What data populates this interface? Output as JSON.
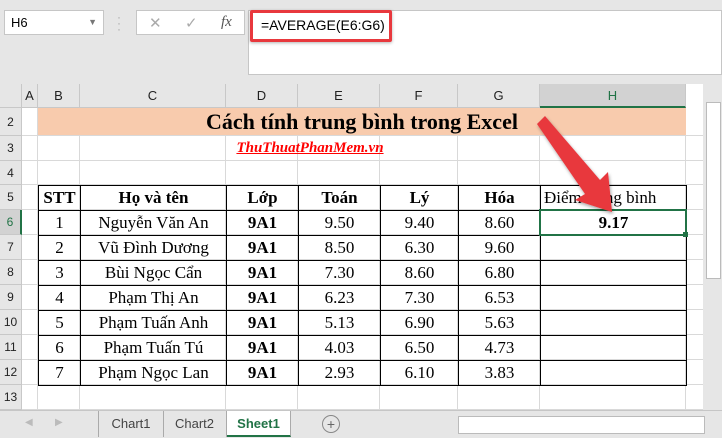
{
  "name_box": "H6",
  "formula_bar": {
    "cancel_icon": "✕",
    "enter_icon": "✓",
    "fx_label": "fx",
    "formula": "=AVERAGE(E6:G6)"
  },
  "columns": [
    "A",
    "B",
    "C",
    "D",
    "E",
    "F",
    "G",
    "H"
  ],
  "rows": [
    "2",
    "3",
    "4",
    "5",
    "6",
    "7",
    "8",
    "9",
    "10",
    "11",
    "12",
    "13"
  ],
  "title": "Cách tính trung bình trong Excel",
  "subtitle": "ThuThuatPhanMem.vn",
  "headers": [
    "STT",
    "Họ và tên",
    "Lớp",
    "Toán",
    "Lý",
    "Hóa",
    "Điểm trung bình"
  ],
  "students": [
    {
      "stt": "1",
      "name": "Nguyễn Văn An",
      "class": "9A1",
      "math": "9.50",
      "physics": "9.40",
      "chem": "8.60",
      "avg": "9.17"
    },
    {
      "stt": "2",
      "name": "Vũ Đình Dương",
      "class": "9A1",
      "math": "8.50",
      "physics": "6.30",
      "chem": "9.60",
      "avg": ""
    },
    {
      "stt": "3",
      "name": "Bùi Ngọc Cẩn",
      "class": "9A1",
      "math": "7.30",
      "physics": "8.60",
      "chem": "6.80",
      "avg": ""
    },
    {
      "stt": "4",
      "name": "Phạm Thị An",
      "class": "9A1",
      "math": "6.23",
      "physics": "7.30",
      "chem": "6.53",
      "avg": ""
    },
    {
      "stt": "5",
      "name": "Phạm Tuấn Anh",
      "class": "9A1",
      "math": "5.13",
      "physics": "6.90",
      "chem": "5.63",
      "avg": ""
    },
    {
      "stt": "6",
      "name": "Phạm Tuấn Tú",
      "class": "9A1",
      "math": "4.03",
      "physics": "6.50",
      "chem": "4.73",
      "avg": ""
    },
    {
      "stt": "7",
      "name": "Phạm Ngọc Lan",
      "class": "9A1",
      "math": "2.93",
      "physics": "6.10",
      "chem": "3.83",
      "avg": ""
    }
  ],
  "sheet_tabs": [
    "Chart1",
    "Chart2",
    "Sheet1"
  ],
  "active_tab": "Sheet1",
  "add_sheet_icon": "+",
  "colors": {
    "title_bg": "#f8cbad",
    "accent": "#217346",
    "arrow": "#e8383d",
    "link": "#ff0000"
  }
}
